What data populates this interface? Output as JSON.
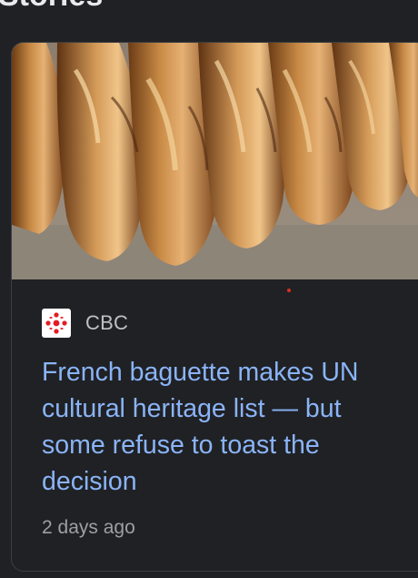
{
  "section": {
    "title": "Stories"
  },
  "story": {
    "image_alt": "Baguettes",
    "source": "CBC",
    "source_logo_icon": "cbc-gem-icon",
    "headline": "French baguette makes UN cultural heritage list — but some refuse to toast the decision",
    "timestamp": "2 days ago"
  },
  "colors": {
    "background": "#202124",
    "headline": "#8ab4f8",
    "source_text": "#bdc1c6",
    "meta_text": "#9aa0a6",
    "logo_red": "#e51b24"
  }
}
